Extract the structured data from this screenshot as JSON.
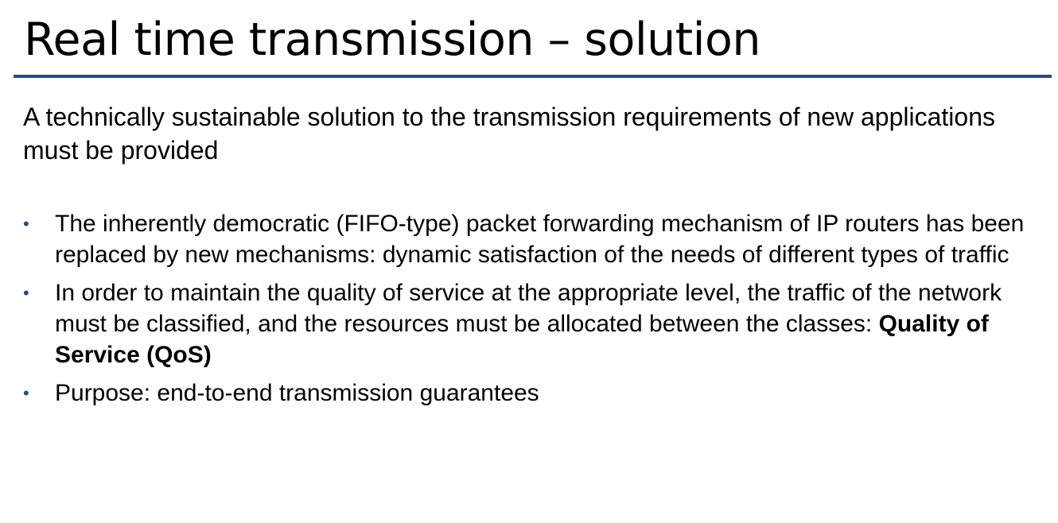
{
  "slide": {
    "title": "Real time transmission – solution",
    "intro": "A technically sustainable solution to the transmission requirements of new applications must be provided",
    "bullets": [
      {
        "text": "The inherently democratic (FIFO-type) packet forwarding mechanism of IP routers has been replaced by new mechanisms: dynamic satisfaction of the needs of different types of traffic"
      },
      {
        "text": "In order to maintain the quality of service at the appropriate level, the traffic of the network must be classified, and the resources must be allocated between the classes: ",
        "bold": "Quality of Service (QoS)"
      },
      {
        "text": "Purpose: end-to-end transmission guarantees"
      }
    ],
    "bullet_glyph": "•"
  },
  "colors": {
    "accent": "#2b4a7a",
    "text": "#000000",
    "background": "#ffffff"
  }
}
